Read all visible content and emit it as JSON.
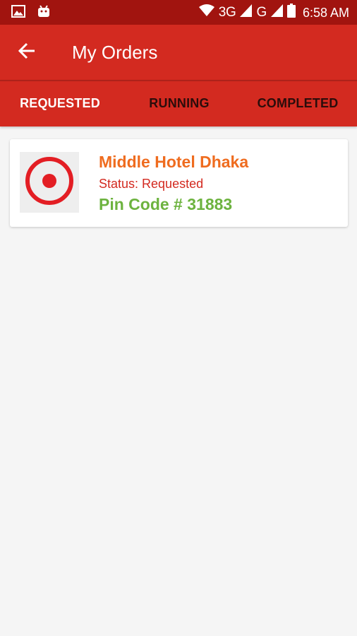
{
  "status_bar": {
    "network_1": "3G",
    "network_2": "G",
    "time": "6:58 AM"
  },
  "app_bar": {
    "title": "My Orders"
  },
  "tabs": [
    {
      "label": "REQUESTED",
      "active": true
    },
    {
      "label": "RUNNING",
      "active": false
    },
    {
      "label": "COMPLETED",
      "active": false
    }
  ],
  "orders": [
    {
      "hotel_name": "Middle Hotel Dhaka",
      "status": "Status: Requested",
      "pin_code": "Pin Code # 31883",
      "icon": "target-icon"
    }
  ],
  "colors": {
    "status_bar": "#a1140f",
    "primary": "#d32a20",
    "hotel_name": "#ef6c1f",
    "pin_code": "#6db33f",
    "background": "#f5f5f5"
  }
}
